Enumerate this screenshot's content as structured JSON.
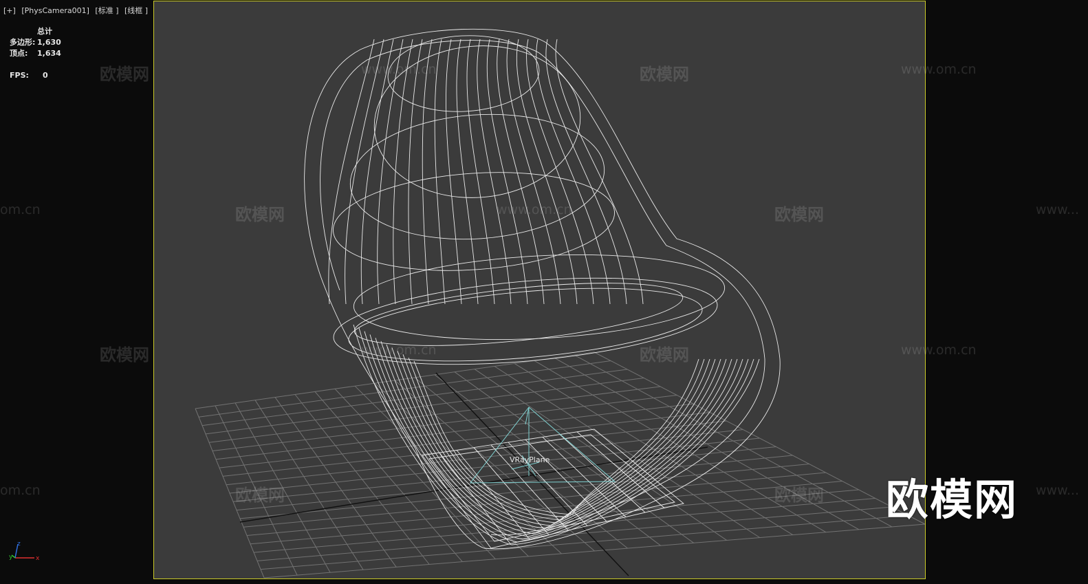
{
  "viewport_label": {
    "plus": "[+]",
    "camera": "[PhysCamera001]",
    "shading": "[标准 ]",
    "mode": "[线框 ]"
  },
  "stats": {
    "header": "总计",
    "polys_label": "多边形:",
    "polys_value": "1,630",
    "verts_label": "顶点:",
    "verts_value": "1,634",
    "fps_label": "FPS:",
    "fps_value": "0"
  },
  "object_label": "VRayPlane",
  "axis": {
    "x": "x",
    "y": "y",
    "z": "z"
  },
  "watermarks": {
    "brand": "欧模网",
    "url": "www.om.cn",
    "url_fragment": "om.cn",
    "url_clipped": "www...",
    "big": "欧模网"
  },
  "colors": {
    "viewport_bg": "#3b3b3b",
    "viewport_border": "#cccc28",
    "grid": "#8a8a8a",
    "wire": "#ffffff",
    "vrayplane": "#7fd0d0"
  }
}
